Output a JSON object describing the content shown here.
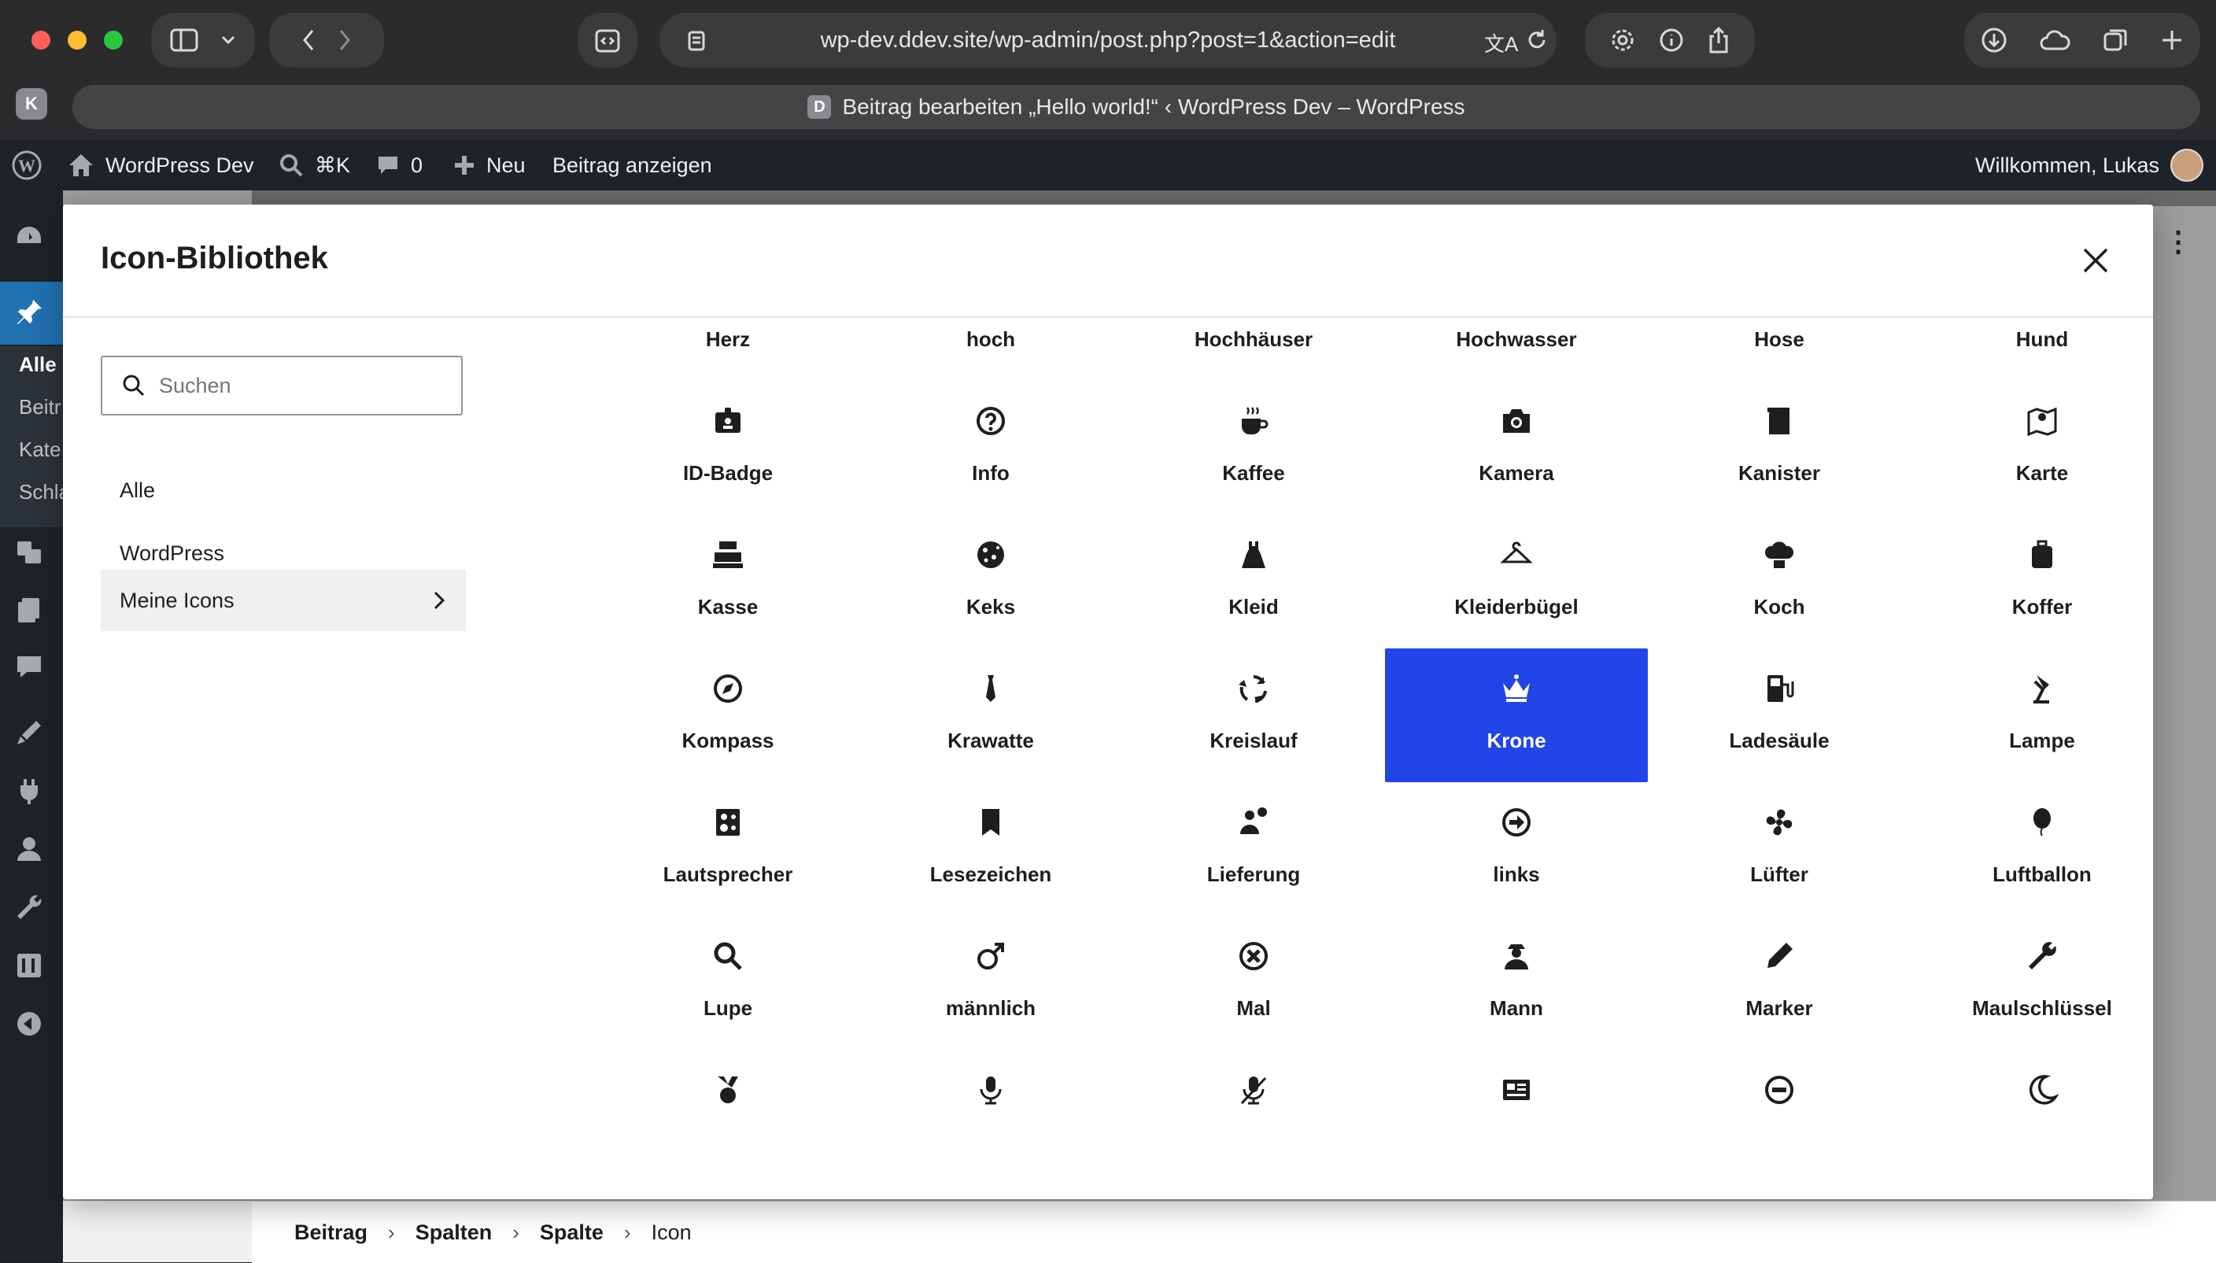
{
  "browser": {
    "url": "wp-dev.ddev.site/wp-admin/post.php?post=1&action=edit",
    "tab_title": "Beitrag bearbeiten „Hello world!“ ‹ WordPress Dev – WordPress",
    "tab_favicon_letter": "D",
    "extension_letter": "K"
  },
  "adminbar": {
    "site_name": "WordPress Dev",
    "shortcut": "⌘K",
    "comments_count": "0",
    "new_label": "Neu",
    "view_post": "Beitrag anzeigen",
    "greeting": "Willkommen, Lukas"
  },
  "sidebar": {
    "submenu": [
      {
        "label": "Alle"
      },
      {
        "label": "Beitr"
      },
      {
        "label": "Kate"
      },
      {
        "label": "Schla"
      }
    ]
  },
  "modal": {
    "title": "Icon-Bibliothek",
    "search_placeholder": "Suchen",
    "categories": [
      {
        "label": "Alle"
      },
      {
        "label": "WordPress"
      },
      {
        "label": "Meine Icons"
      }
    ],
    "selected_icon": "Krone",
    "selected_color": "#2145e6",
    "icons": [
      {
        "label": "Herz",
        "icon": "heart-icon"
      },
      {
        "label": "hoch",
        "icon": "arrow-up-circle-icon"
      },
      {
        "label": "Hochhäuser",
        "icon": "buildings-icon"
      },
      {
        "label": "Hochwasser",
        "icon": "flood-icon"
      },
      {
        "label": "Hose",
        "icon": "pants-icon"
      },
      {
        "label": "Hund",
        "icon": "dog-icon"
      },
      {
        "label": "ID-Badge",
        "icon": "id-badge-icon"
      },
      {
        "label": "Info",
        "icon": "question-circle-icon"
      },
      {
        "label": "Kaffee",
        "icon": "coffee-icon"
      },
      {
        "label": "Kamera",
        "icon": "camera-icon"
      },
      {
        "label": "Kanister",
        "icon": "jerrycan-icon"
      },
      {
        "label": "Karte",
        "icon": "map-icon"
      },
      {
        "label": "Kasse",
        "icon": "cash-register-icon"
      },
      {
        "label": "Keks",
        "icon": "cookie-icon"
      },
      {
        "label": "Kleid",
        "icon": "dress-icon"
      },
      {
        "label": "Kleiderbügel",
        "icon": "hanger-icon"
      },
      {
        "label": "Koch",
        "icon": "chef-hat-icon"
      },
      {
        "label": "Koffer",
        "icon": "suitcase-icon"
      },
      {
        "label": "Kompass",
        "icon": "compass-icon"
      },
      {
        "label": "Krawatte",
        "icon": "tie-icon"
      },
      {
        "label": "Kreislauf",
        "icon": "cycle-icon"
      },
      {
        "label": "Krone",
        "icon": "crown-icon"
      },
      {
        "label": "Ladesäule",
        "icon": "charging-station-icon"
      },
      {
        "label": "Lampe",
        "icon": "desk-lamp-icon"
      },
      {
        "label": "Lautsprecher",
        "icon": "speaker-icon"
      },
      {
        "label": "Lesezeichen",
        "icon": "bookmark-icon"
      },
      {
        "label": "Lieferung",
        "icon": "delivery-icon"
      },
      {
        "label": "links",
        "icon": "arrow-circle-icon"
      },
      {
        "label": "Lüfter",
        "icon": "fan-icon"
      },
      {
        "label": "Luftballon",
        "icon": "balloon-icon"
      },
      {
        "label": "Lupe",
        "icon": "magnifier-icon"
      },
      {
        "label": "männlich",
        "icon": "male-icon"
      },
      {
        "label": "Mal",
        "icon": "times-circle-icon"
      },
      {
        "label": "Mann",
        "icon": "man-icon"
      },
      {
        "label": "Marker",
        "icon": "marker-icon"
      },
      {
        "label": "Maulschlüssel",
        "icon": "wrench-icon"
      },
      {
        "label": "",
        "icon": "medal-icon"
      },
      {
        "label": "",
        "icon": "microphone-icon"
      },
      {
        "label": "",
        "icon": "microphone-off-icon"
      },
      {
        "label": "",
        "icon": "news-icon"
      },
      {
        "label": "",
        "icon": "minus-circle-icon"
      },
      {
        "label": "",
        "icon": "moon-icon"
      }
    ]
  },
  "breadcrumbs": [
    {
      "label": "Beitrag"
    },
    {
      "label": "Spalten"
    },
    {
      "label": "Spalte"
    },
    {
      "label": "Icon"
    }
  ]
}
